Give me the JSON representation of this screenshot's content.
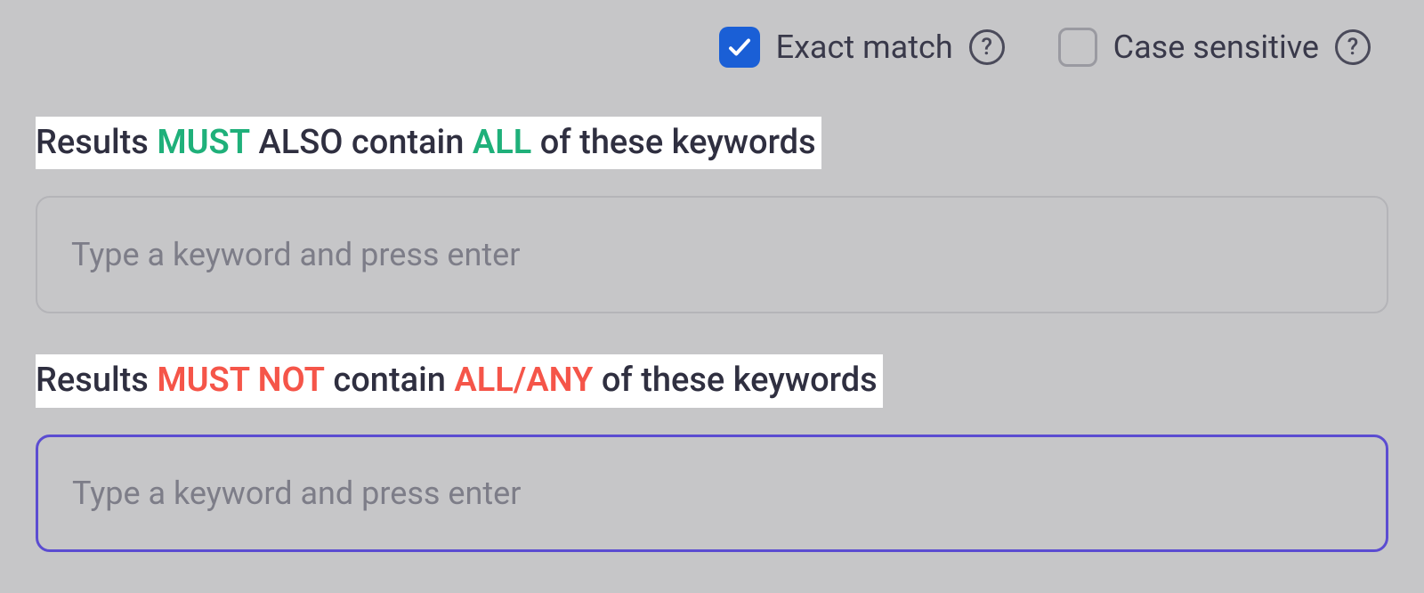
{
  "options": {
    "exact_match": {
      "label": "Exact match",
      "checked": true
    },
    "case_sensitive": {
      "label": "Case sensitive",
      "checked": false
    },
    "help_glyph": "?"
  },
  "must_section": {
    "heading_parts": {
      "p1": "Results ",
      "p2": "MUST",
      "p3": " ALSO contain ",
      "p4": "ALL",
      "p5": " of these keywords"
    },
    "placeholder": "Type a keyword and press enter",
    "value": ""
  },
  "must_not_section": {
    "heading_parts": {
      "p1": "Results ",
      "p2": "MUST NOT",
      "p3": " contain ",
      "p4": "ALL/ANY",
      "p5": " of these keywords"
    },
    "placeholder": "Type a keyword and press enter",
    "value": ""
  },
  "colors": {
    "green": "#1fb07a",
    "red": "#f55549",
    "focus_border": "#5b4cd1",
    "checkbox_checked_bg": "#1a5fd6"
  }
}
